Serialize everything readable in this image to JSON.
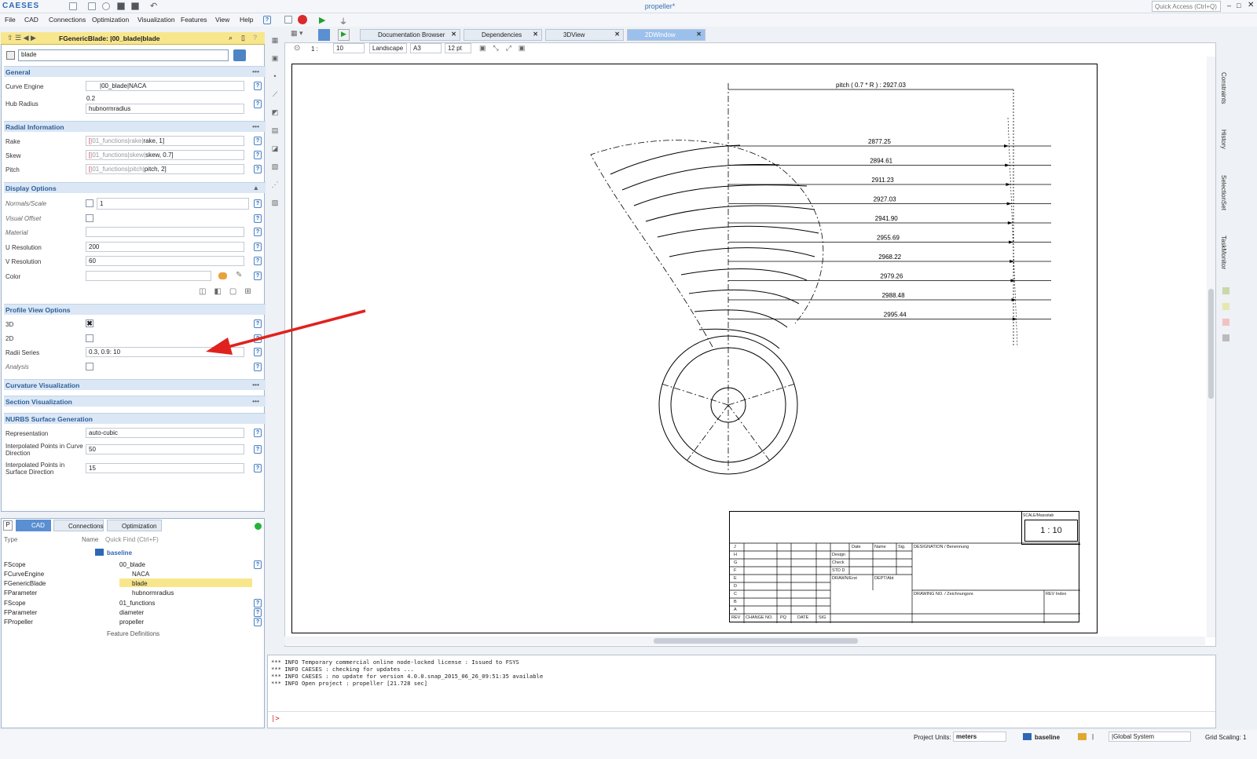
{
  "app": {
    "logo": "CAESES",
    "title": "propeller*",
    "quick_access": "Quick Access (Ctrl+Q)"
  },
  "menu": [
    "File",
    "CAD",
    "Connections",
    "Optimization",
    "Visualization",
    "Features",
    "View",
    "Help"
  ],
  "properties": {
    "header": "FGenericBlade: |00_blade|blade",
    "name_value": "blade",
    "sections": {
      "general": "General",
      "radial": "Radial Information",
      "display": "Display Options",
      "profile": "Profile View Options",
      "curvature": "Curvature Visualization",
      "section": "Section Visualization",
      "nurbs": "NURBS Surface Generation"
    },
    "general": {
      "curve_engine_label": "Curve Engine",
      "curve_engine_value": "|00_blade|NACA",
      "hub_radius_label": "Hub Radius",
      "hub_radius_top": "0.2",
      "hub_radius_value": "hubnormradius"
    },
    "radial": {
      "rake_label": "Rake",
      "rake_prefix": "[",
      "rake_ref": "|01_functions|rake|",
      "rake_value": "rake, 1]",
      "skew_label": "Skew",
      "skew_prefix": "[",
      "skew_ref": "|01_functions|skew|",
      "skew_value": "skew, 0.7]",
      "pitch_label": "Pitch",
      "pitch_prefix": "[",
      "pitch_ref": "|01_functions|pitch|",
      "pitch_value": "pitch, 2]"
    },
    "display": {
      "normals_label": "Normals/Scale",
      "normals_value": "1",
      "visual_offset_label": "Visual Offset",
      "material_label": "Material",
      "material_value": "",
      "u_res_label": "U Resolution",
      "u_res_value": "200",
      "v_res_label": "V Resolution",
      "v_res_value": "60",
      "color_label": "Color"
    },
    "profile": {
      "3d_label": "3D",
      "2d_label": "2D",
      "radii_label": "Radii Series",
      "radii_value": "0.3, 0.9: 10",
      "analysis_label": "Analysis"
    },
    "nurbs": {
      "repr_label": "Representation",
      "repr_value": "auto-cubic",
      "curve_pts_label_1": "Interpolated Points in Curve",
      "curve_pts_label_2": "Direction",
      "curve_pts_value": "50",
      "surf_pts_label_1": "Interpolated Points in",
      "surf_pts_label_2": "Surface Direction",
      "surf_pts_value": "15"
    }
  },
  "tree": {
    "tabs": [
      "P",
      "CAD",
      "Connections",
      "Optimization"
    ],
    "type_header": "Type",
    "name_header": "Name",
    "quick_find": "Quick Find (Ctrl+F)",
    "root": "baseline",
    "rows": [
      {
        "type": "FScope",
        "name": "00_blade"
      },
      {
        "type": "FCurveEngine",
        "name": "NACA"
      },
      {
        "type": "FGenericBlade",
        "name": "blade"
      },
      {
        "type": "FParameter",
        "name": "hubnormradius"
      },
      {
        "type": "FScope",
        "name": "01_functions"
      },
      {
        "type": "FParameter",
        "name": "diameter"
      },
      {
        "type": "FPropeller",
        "name": "propeller"
      },
      {
        "type": "",
        "name": "Feature Definitions"
      }
    ]
  },
  "tabs": [
    "Documentation Browser",
    "Dependencies",
    "3DView",
    "2DWindow"
  ],
  "view_toolbar": {
    "scale_prefix": "1 :",
    "scale_value": "10",
    "orientation": "Landscape",
    "paper": "A3",
    "font": "12 pt"
  },
  "drawing": {
    "pitch_label": "pitch ( 0.7 * R ) : 2927.03",
    "dims": [
      "2877.25",
      "2894.61",
      "2911.23",
      "2927.03",
      "2941.90",
      "2955.69",
      "2968.22",
      "2979.26",
      "2988.48",
      "2995.44"
    ],
    "title_block": {
      "scale_label": "SCALE/Massstab",
      "scale_value": "1 : 10",
      "rev_letters": [
        "J",
        "H",
        "G",
        "F",
        "E",
        "D",
        "C",
        "B",
        "A"
      ],
      "col_heads": [
        "REV",
        "CHANGE NO.",
        "PQ",
        "DATE",
        "SIG"
      ],
      "date": "Date",
      "name": "Name",
      "sig": "Sig.",
      "designation": "DESIGNATION / Benennung",
      "design": "Design",
      "check": "Check",
      "std": "STD D",
      "drawn": "DRAWN/Erst",
      "dept": "DEPT/Abt",
      "drawing_no": "DRAWING NO. / Zeichnungsnr.",
      "rev_index": "REV Index"
    }
  },
  "console": [
    "*** INFO Temporary commercial online node-locked license : Issued to FSYS",
    "*** INFO CAESES : checking for updates ...",
    "*** INFO CAESES : no update for version 4.0.0.snap_2015_06_26_09:51:35 available",
    "*** INFO Open project : propeller [21.728 sec]"
  ],
  "console_prompt": "|>",
  "side_tabs": [
    "Constraints",
    "History",
    "SelectionSet",
    "TaskMonitor"
  ],
  "status": {
    "units_label": "Project Units:",
    "units_value": "meters",
    "scope": "baseline",
    "separator": "|",
    "cs": "|Global System",
    "grid": "Grid Scaling: 1"
  },
  "colors": {
    "accent": "#2d67b5",
    "header_yellow": "#f8e68d",
    "section_bg": "#dbe7f5",
    "arrow": "#e0221e"
  }
}
